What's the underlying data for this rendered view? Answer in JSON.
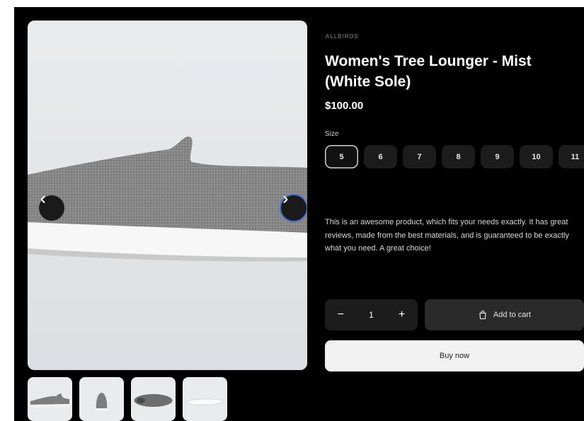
{
  "product": {
    "vendor": "ALLBIRDS",
    "title": "Women's Tree Lounger - Mist (White Sole)",
    "price": "$100.00",
    "description": "This is an awesome product, which fits your needs exactly. It has great reviews, made from the best materials, and is guaranteed to be exactly what you need. A great choice!"
  },
  "gallery": {
    "prev_icon": "chevron-left-icon",
    "next_icon": "chevron-right-icon",
    "thumbnail_count": 4,
    "selected_thumbnail": 1
  },
  "size_selector": {
    "label": "Size",
    "options": [
      "5",
      "6",
      "7",
      "8",
      "9",
      "10",
      "11"
    ],
    "selected": "5"
  },
  "cart": {
    "quantity": "1",
    "minus_label": "−",
    "plus_label": "+",
    "add_to_cart_label": "Add to cart",
    "cart_icon": "shopping-bag-icon",
    "buy_now_label": "Buy now"
  },
  "colors": {
    "background": "#000000",
    "image_bg": "#e6e8ea",
    "focus_ring": "#3f6fd1",
    "primary_button": "#f2f2f2"
  }
}
